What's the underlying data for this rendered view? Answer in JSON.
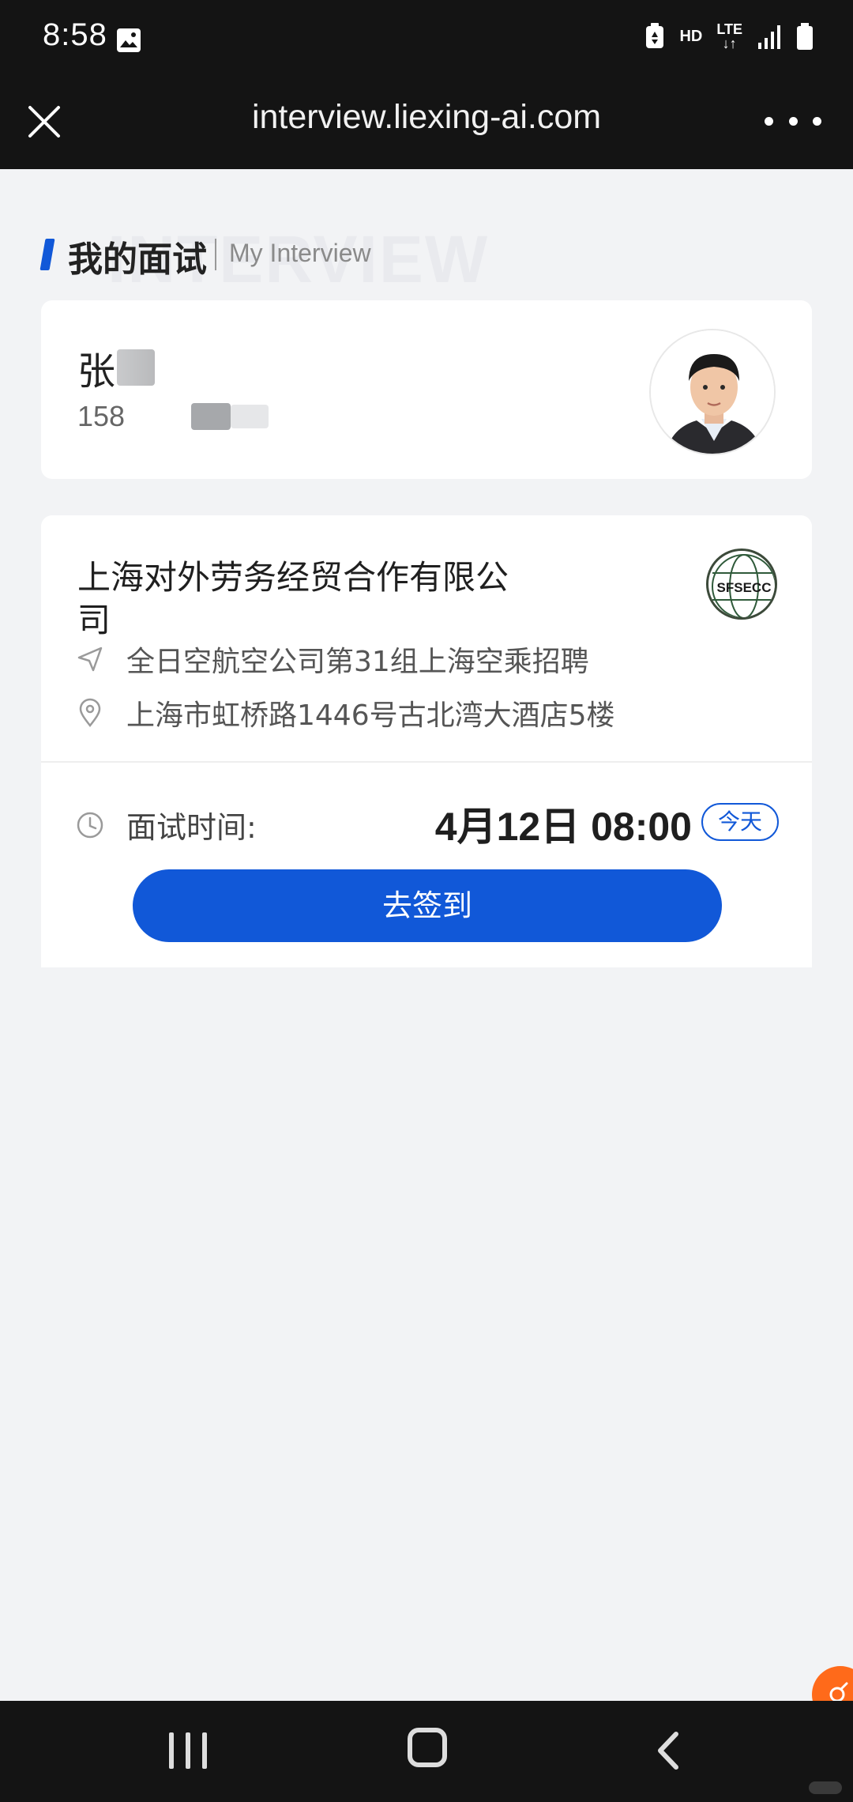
{
  "status_bar": {
    "time": "8:58",
    "hd": "HD",
    "lte": "LTE",
    "icons": [
      "gallery-icon",
      "battery-saver-icon",
      "signal-icon",
      "battery-icon"
    ]
  },
  "browser": {
    "url": "interview.liexing-ai.com",
    "close_icon": "close-icon",
    "more_icon": "more-icon"
  },
  "section": {
    "title_cn": "我的面试",
    "title_en": "My Interview",
    "watermark": "INTERVIEW"
  },
  "profile": {
    "name_visible": "张",
    "phone_visible": "158"
  },
  "interview": {
    "company": "上海对外劳务经贸合作有限公司",
    "logo_text": "SFSECC",
    "position": "全日空航空公司第31组上海空乘招聘",
    "address": "上海市虹桥路1446号古北湾大酒店5楼",
    "time_label": "面试时间:",
    "time_value": "4月12日 08:00",
    "badge": "今天",
    "checkin_button": "去签到"
  },
  "colors": {
    "accent": "#1158d8",
    "bar_bg": "#141414",
    "page_bg": "#f2f3f5",
    "float_btn": "#ff6a1a"
  }
}
